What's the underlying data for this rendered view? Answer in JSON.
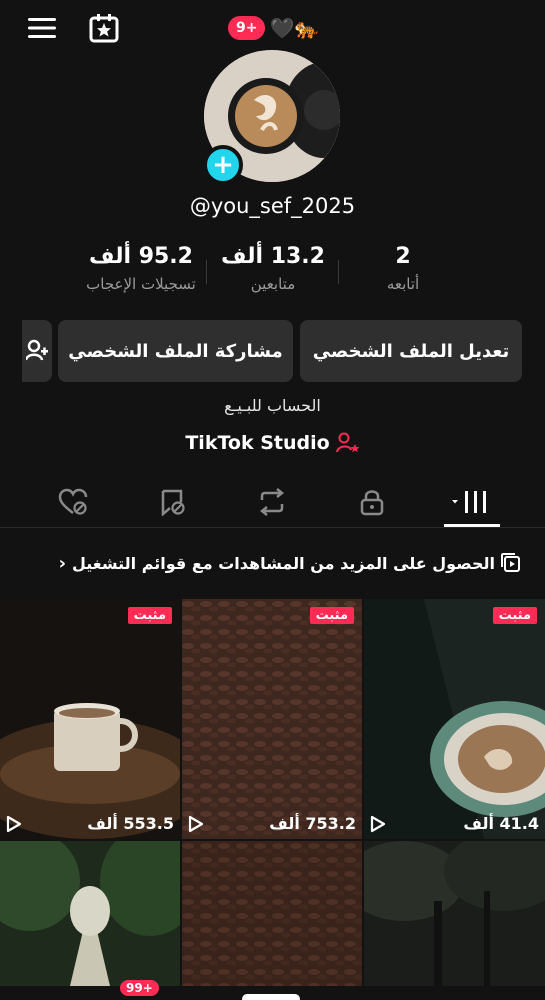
{
  "top_bar": {
    "menu_icon": "hamburger-menu-icon",
    "calendar_icon": "calendar-star-icon",
    "notification_badge": "9+",
    "name_emoji": "🖤🐅"
  },
  "profile": {
    "username": "@you_sef_2025",
    "add_icon": "plus-icon"
  },
  "stats": [
    {
      "value": "2",
      "label": "أتابعه"
    },
    {
      "value": "13.2 ألف",
      "label": "متابعين"
    },
    {
      "value": "95.2 ألف",
      "label": "تسجيلات الإعجاب"
    }
  ],
  "buttons": {
    "edit_profile": "تعديل الملف الشخصي",
    "share_profile": "مشاركة الملف الشخصي",
    "add_friend_icon": "add-person-icon"
  },
  "bio": "الحساب للبـيـع",
  "studio": {
    "label": "TikTok Studio",
    "icon": "person-star-icon"
  },
  "tabs": [
    {
      "icon": "videos-grid-icon",
      "selected": true
    },
    {
      "icon": "lock-icon",
      "selected": false
    },
    {
      "icon": "repost-icon",
      "selected": false
    },
    {
      "icon": "bookmark-icon",
      "selected": false
    },
    {
      "icon": "liked-heart-icon",
      "selected": false
    }
  ],
  "promo_text": "الحصول على المزيد من المشاهدات مع قوائم التشغيل",
  "videos": [
    {
      "pinned_label": "مثبت",
      "views": "41.4 ألف"
    },
    {
      "pinned_label": "مثبت",
      "views": "753.2 ألف"
    },
    {
      "pinned_label": "مثبت",
      "views": "553.5 ألف"
    },
    {
      "pinned_label": "",
      "views": ""
    },
    {
      "pinned_label": "",
      "views": ""
    },
    {
      "pinned_label": "",
      "views": ""
    }
  ],
  "bottom_nav": {
    "badge": "99+"
  },
  "colors": {
    "background": "#121212",
    "accent_red": "#fe2c55",
    "accent_cyan": "#20d5ec",
    "button_bg": "#2f2f2f"
  }
}
